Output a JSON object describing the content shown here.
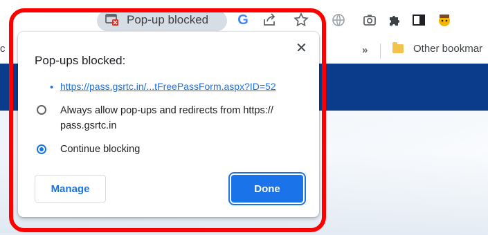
{
  "toolbar": {
    "blocked_indicator": "Pop-up blocked",
    "google_icon_label": "G",
    "icons": [
      "share-icon",
      "star-icon",
      "globe-icon",
      "camera-icon",
      "puzzle-icon",
      "sidebar-icon",
      "profile-icon"
    ]
  },
  "bookmarks_bar": {
    "chevron": "»",
    "other_bookmarks": "Other bookmar",
    "left_stub": "c"
  },
  "popup": {
    "title": "Pop-ups blocked:",
    "close_glyph": "✕",
    "blocked_url": "https://pass.gsrtc.in/...tFreePassForm.aspx?ID=52",
    "options": [
      {
        "label": "Always allow pop-ups and redirects from https://",
        "label_line2": "pass.gsrtc.in",
        "selected": false
      },
      {
        "label": "Continue blocking",
        "selected": true
      }
    ],
    "manage_label": "Manage",
    "done_label": "Done"
  },
  "colors": {
    "accent": "#1a73e8",
    "highlight": "#ff0000",
    "page_banner": "#0b3c8c"
  }
}
